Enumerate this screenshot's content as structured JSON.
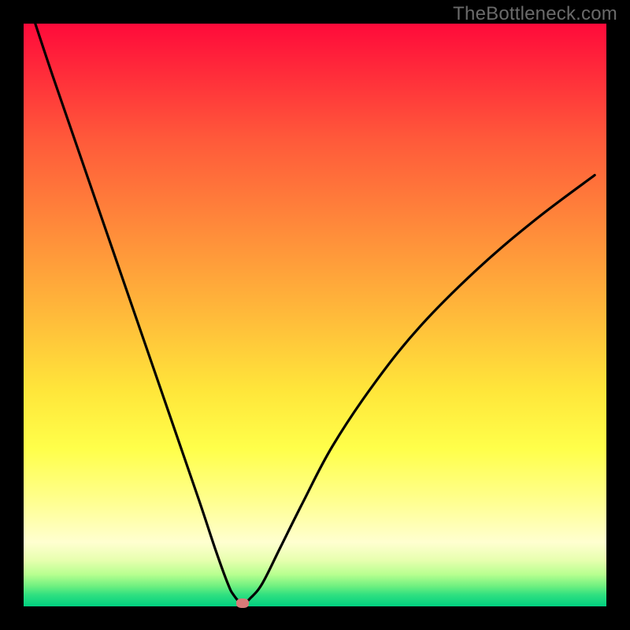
{
  "watermark": "TheBottleneck.com",
  "colors": {
    "background": "#000000",
    "gradient_top": "#ff0a3a",
    "gradient_bottom": "#00d080",
    "curve": "#000000",
    "marker": "#d87a78"
  },
  "chart_data": {
    "type": "line",
    "title": "",
    "xlabel": "",
    "ylabel": "",
    "xlim": [
      0,
      100
    ],
    "ylim": [
      0,
      100
    ],
    "series": [
      {
        "name": "bottleneck-curve",
        "x": [
          2,
          5,
          10,
          15,
          20,
          25,
          30,
          33,
          35,
          36,
          37.5,
          39,
          41,
          44,
          48,
          53,
          60,
          68,
          78,
          88,
          98
        ],
        "y": [
          100,
          91,
          76.5,
          62,
          47.5,
          33,
          18.5,
          9.5,
          4,
          2,
          0.5,
          1.5,
          4,
          10,
          18,
          27.5,
          38,
          48,
          58,
          66.5,
          74
        ]
      }
    ],
    "marker": {
      "x": 37.5,
      "y": 0.5
    },
    "annotations": []
  }
}
